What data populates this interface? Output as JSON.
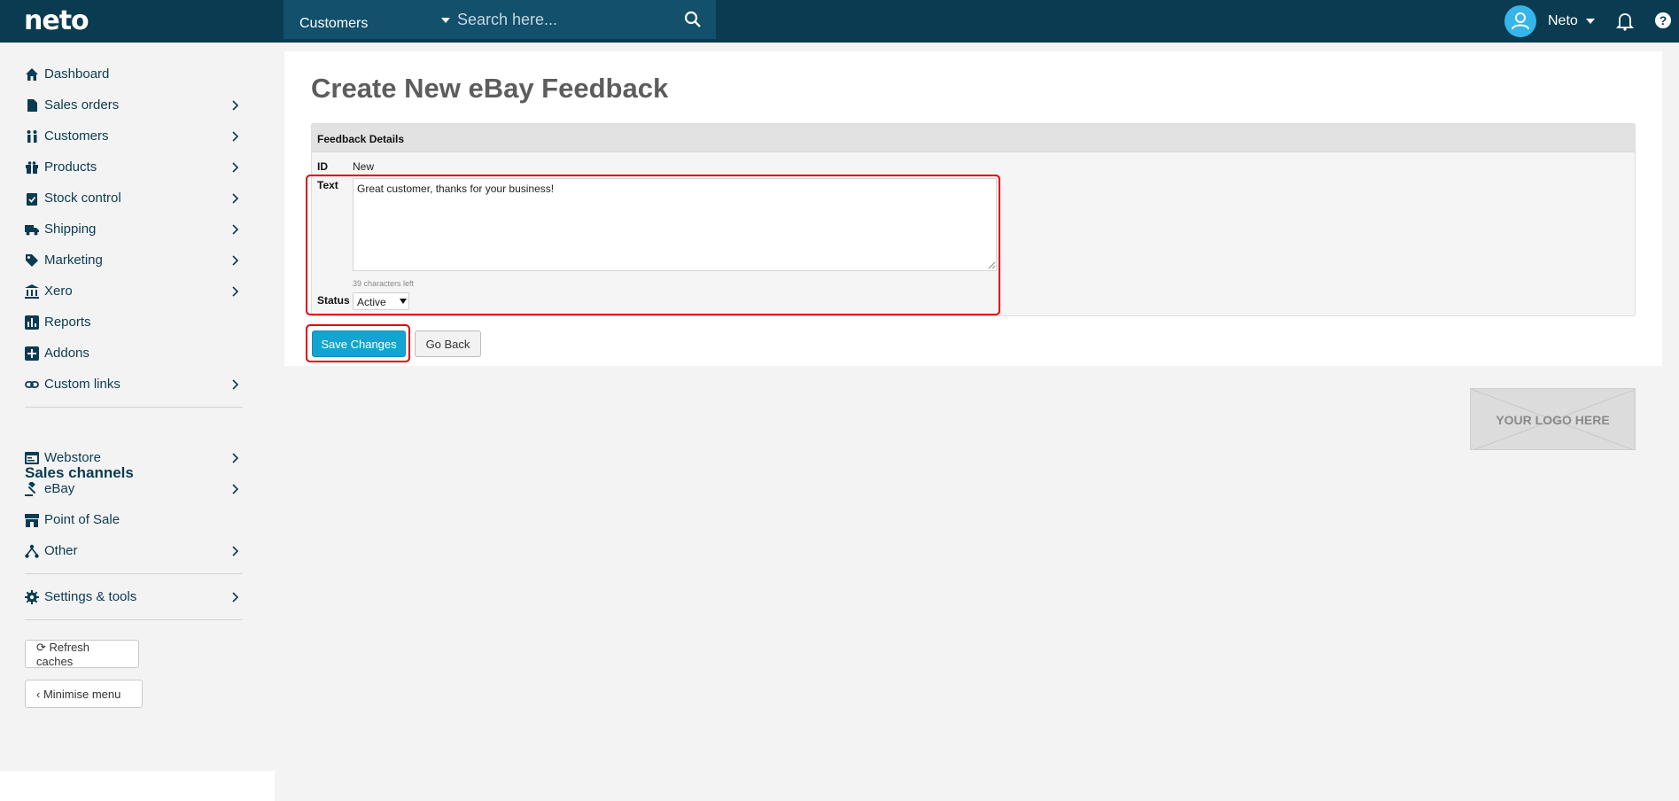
{
  "app": {
    "logo": "neto"
  },
  "header": {
    "context": "Customers",
    "search_placeholder": "Search here...",
    "user_name": "Neto"
  },
  "sidebar": {
    "items": [
      {
        "label": "Dashboard",
        "icon": "home-icon"
      },
      {
        "label": "Sales orders",
        "icon": "document-icon"
      },
      {
        "label": "Customers",
        "icon": "people-icon"
      },
      {
        "label": "Products",
        "icon": "gift-icon"
      },
      {
        "label": "Stock control",
        "icon": "clipboard-check-icon"
      },
      {
        "label": "Shipping",
        "icon": "truck-icon"
      },
      {
        "label": "Marketing",
        "icon": "tag-icon"
      },
      {
        "label": "Xero",
        "icon": "bank-icon"
      },
      {
        "label": "Reports",
        "icon": "chart-icon"
      },
      {
        "label": "Addons",
        "icon": "plus-square-icon"
      },
      {
        "label": "Custom links",
        "icon": "link-icon"
      }
    ],
    "sales_channels_heading": "Sales channels",
    "channels": [
      {
        "label": "Webstore",
        "icon": "browser-icon"
      },
      {
        "label": "eBay",
        "icon": "gavel-icon"
      },
      {
        "label": "Point of Sale",
        "icon": "store-icon"
      },
      {
        "label": "Other",
        "icon": "network-icon"
      }
    ],
    "settings": {
      "label": "Settings & tools",
      "icon": "gear-icon"
    },
    "refresh_label": "Refresh caches",
    "minimise_label": "Minimise menu"
  },
  "main": {
    "title": "Create New eBay Feedback",
    "section_title": "Feedback Details",
    "id_label": "ID",
    "id_value": "New",
    "text_label": "Text",
    "text_value": "Great customer, thanks for your business!",
    "chars_left": "39 characters left",
    "status_label": "Status",
    "status_value": "Active",
    "save_label": "Save Changes",
    "back_label": "Go Back",
    "logo_placeholder": "YOUR LOGO HERE"
  },
  "colors": {
    "topbar": "#0a3b50",
    "accent": "#13a4d1",
    "nav_text": "#0b3b52",
    "highlight": "#e00000"
  }
}
